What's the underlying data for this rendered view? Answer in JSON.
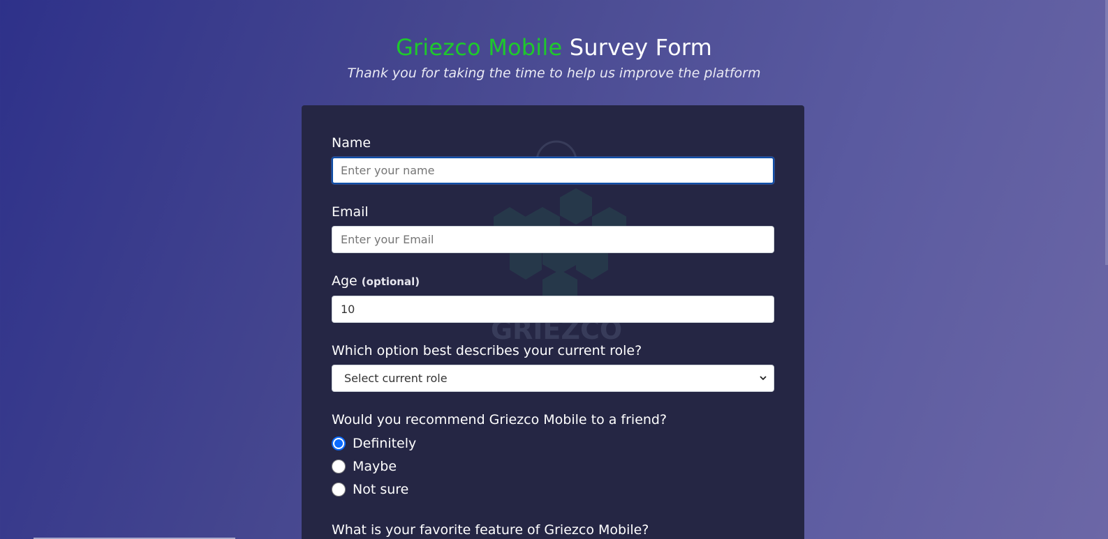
{
  "header": {
    "brand": "Griezco Mobile",
    "title_rest": "Survey Form",
    "subtitle": "Thank you for taking the time to help us improve the platform"
  },
  "form": {
    "name": {
      "label": "Name",
      "placeholder": "Enter your name",
      "value": ""
    },
    "email": {
      "label": "Email",
      "placeholder": "Enter your Email",
      "value": ""
    },
    "age": {
      "label": "Age",
      "optional": "(optional)",
      "value": "10"
    },
    "role": {
      "label": "Which option best describes your current role?",
      "selected": "Select current role"
    },
    "recommend": {
      "question": "Would you recommend Griezco Mobile to a friend?",
      "options": [
        "Definitely",
        "Maybe",
        "Not sure"
      ],
      "selected_index": 0
    },
    "feature": {
      "label": "What is your favorite feature of Griezco Mobile?"
    }
  },
  "watermark": {
    "icon": "griezco-logo-icon",
    "text": "GRIEZCO"
  },
  "colors": {
    "brand_green": "#1ec92c",
    "card_bg": "#252644",
    "radio_blue": "#0b6bff"
  }
}
